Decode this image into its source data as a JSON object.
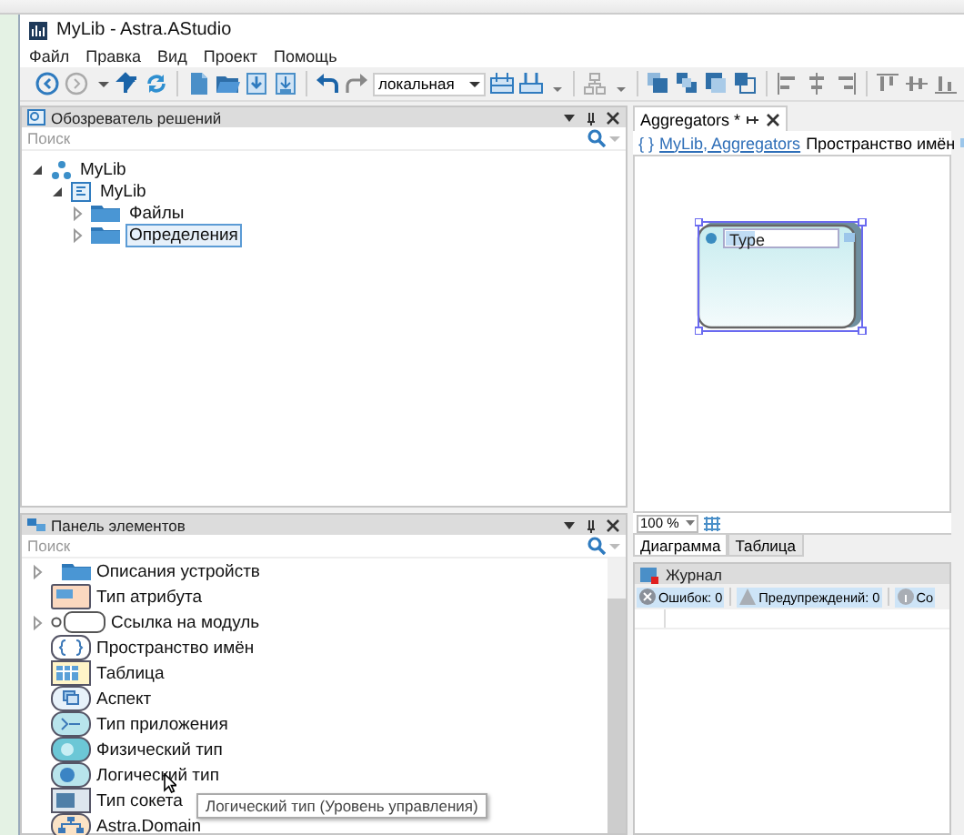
{
  "window": {
    "title": "MyLib - Astra.AStudio"
  },
  "menu": [
    "Файл",
    "Правка",
    "Вид",
    "Проект",
    "Помощь"
  ],
  "toolbar": {
    "configuration": "локальная"
  },
  "solution_explorer": {
    "title": "Обозреватель решений",
    "search": {
      "placeholder": "Поиск"
    },
    "tree": [
      {
        "label": "MyLib",
        "kind": "solution",
        "expanded": true,
        "selected": false,
        "children": [
          {
            "label": "MyLib",
            "kind": "project",
            "expanded": true,
            "selected": false,
            "children": [
              {
                "label": "Файлы",
                "kind": "folder",
                "expanded": false,
                "selected": false
              },
              {
                "label": "Определения",
                "kind": "folder",
                "expanded": false,
                "selected": true
              }
            ]
          }
        ]
      }
    ]
  },
  "toolbox": {
    "title": "Панель элементов",
    "search": {
      "placeholder": "Поиск"
    },
    "items": [
      {
        "label": "Описания устройств",
        "kind": "folder",
        "expandable": true
      },
      {
        "label": "Тип атрибута",
        "kind": "attribute",
        "expandable": false
      },
      {
        "label": "Ссылка на модуль",
        "kind": "module-link",
        "expandable": true
      },
      {
        "label": "Пространство имён",
        "kind": "namespace",
        "expandable": false
      },
      {
        "label": "Таблица",
        "kind": "table",
        "expandable": false
      },
      {
        "label": "Аспект",
        "kind": "aspect",
        "expandable": false
      },
      {
        "label": "Тип приложения",
        "kind": "app-type",
        "expandable": false
      },
      {
        "label": "Физический тип",
        "kind": "physical",
        "expandable": false
      },
      {
        "label": "Логический тип",
        "kind": "logical",
        "expandable": false
      },
      {
        "label": "Тип сокета",
        "kind": "socket",
        "expandable": false
      },
      {
        "label": "Astra.Domain",
        "kind": "domain",
        "expandable": false
      }
    ],
    "tooltip": "Логический тип (Уровень управления)"
  },
  "editor": {
    "tabs": [
      {
        "label": "Aggregators *",
        "selected": true
      }
    ],
    "breadcrumb": {
      "braces": "{ }",
      "link": "MyLib, Aggregators",
      "kind_label": "Пространство имён"
    },
    "shape": {
      "name": "Type"
    },
    "zoom": "100 %",
    "view_tabs": [
      {
        "label": "Диаграмма",
        "selected": true
      },
      {
        "label": "Таблица",
        "selected": false
      }
    ]
  },
  "journal": {
    "title": "Журнал",
    "filters": [
      {
        "label": "Ошибок: 0",
        "kind": "error"
      },
      {
        "label": "Предупреждений: 0",
        "kind": "warning"
      },
      {
        "label": "Со",
        "kind": "message"
      }
    ]
  }
}
